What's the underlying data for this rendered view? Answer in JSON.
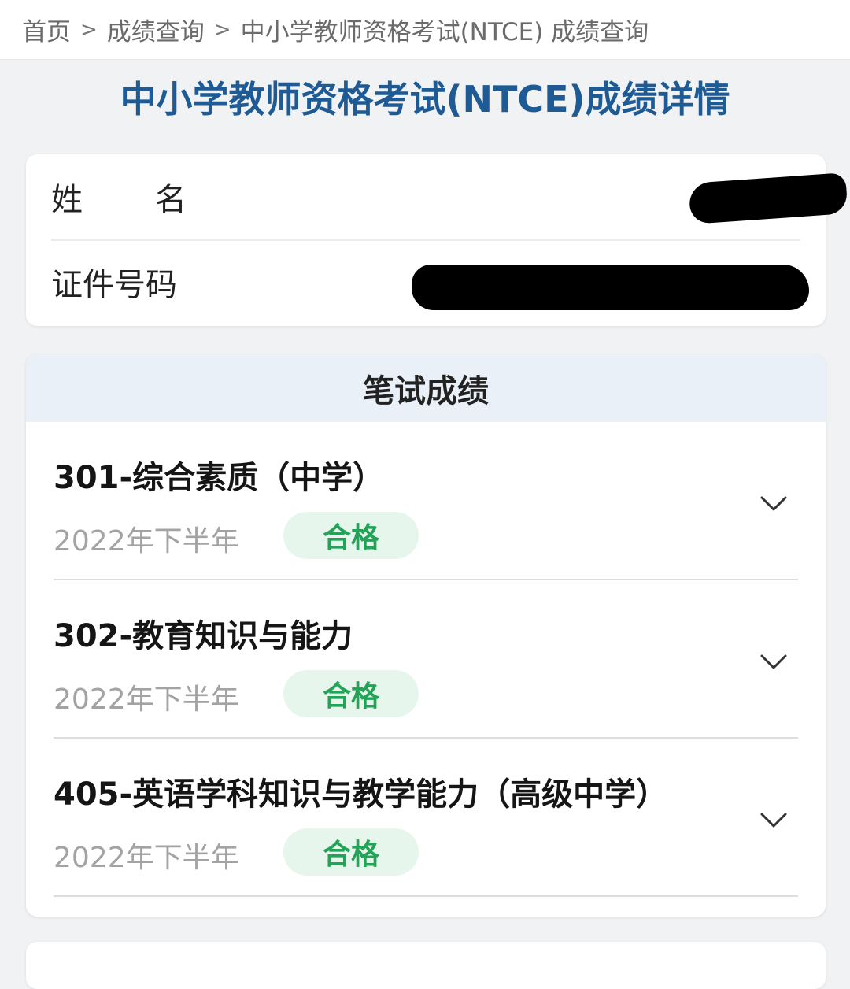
{
  "breadcrumb": {
    "items": [
      "首页",
      "成绩查询",
      "中小学教师资格考试(NTCE) 成绩查询"
    ],
    "separator": ">"
  },
  "page": {
    "title": "中小学教师资格考试(NTCE)成绩详情"
  },
  "info": {
    "name_label": "姓名",
    "id_label": "证件号码"
  },
  "written_scores": {
    "header": "笔试成绩",
    "subjects": [
      {
        "title": "301-综合素质（中学）",
        "term": "2022年下半年",
        "result": "合格"
      },
      {
        "title": "302-教育知识与能力",
        "term": "2022年下半年",
        "result": "合格"
      },
      {
        "title": "405-英语学科知识与教学能力（高级中学）",
        "term": "2022年下半年",
        "result": "合格"
      }
    ]
  },
  "colors": {
    "title_blue": "#1e5a94",
    "pass_green": "#22a357",
    "pass_bg": "#e7f6ec",
    "header_bg": "#eaf0f8"
  },
  "icons": {
    "expand": "chevron-down-icon"
  }
}
